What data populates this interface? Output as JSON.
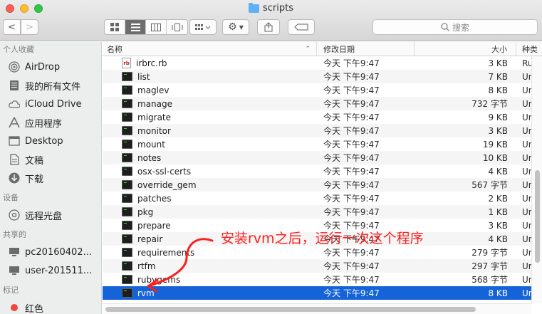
{
  "window": {
    "title": "scripts"
  },
  "toolbar": {
    "back_label": "<",
    "forward_label": ">",
    "search_placeholder": "搜索"
  },
  "sidebar": {
    "sections": [
      {
        "title": "个人收藏",
        "items": [
          {
            "label": "AirDrop",
            "icon": "airdrop-icon"
          },
          {
            "label": "我的所有文件",
            "icon": "all-files-icon"
          },
          {
            "label": "iCloud Drive",
            "icon": "cloud-icon"
          },
          {
            "label": "应用程序",
            "icon": "applications-icon"
          },
          {
            "label": "Desktop",
            "icon": "desktop-icon"
          },
          {
            "label": "文稿",
            "icon": "documents-icon"
          },
          {
            "label": "下载",
            "icon": "downloads-icon"
          }
        ]
      },
      {
        "title": "设备",
        "items": [
          {
            "label": "远程光盘",
            "icon": "disc-icon"
          }
        ]
      },
      {
        "title": "共享的",
        "items": [
          {
            "label": "pc20160402...",
            "icon": "computer-icon"
          },
          {
            "label": "user-201511...",
            "icon": "computer-icon"
          }
        ]
      },
      {
        "title": "标记",
        "items": [
          {
            "label": "红色",
            "icon": "red-tag-icon"
          }
        ]
      }
    ]
  },
  "columns": {
    "name": "名称",
    "date": "修改日期",
    "size": "大小",
    "kind": "种类"
  },
  "files": [
    {
      "name": "irbrc.rb",
      "date": "今天 下午9:47",
      "size": "3 KB",
      "kind": "Ruby",
      "icon": "ruby-file-icon"
    },
    {
      "name": "list",
      "date": "今天 下午9:47",
      "size": "7 KB",
      "kind": "Unix",
      "icon": "terminal-icon"
    },
    {
      "name": "maglev",
      "date": "今天 下午9:47",
      "size": "8 KB",
      "kind": "Unix",
      "icon": "terminal-icon"
    },
    {
      "name": "manage",
      "date": "今天 下午9:47",
      "size": "732 字节",
      "kind": "Unix",
      "icon": "terminal-icon"
    },
    {
      "name": "migrate",
      "date": "今天 下午9:47",
      "size": "9 KB",
      "kind": "Unix",
      "icon": "terminal-icon"
    },
    {
      "name": "monitor",
      "date": "今天 下午9:47",
      "size": "3 KB",
      "kind": "Unix",
      "icon": "terminal-icon"
    },
    {
      "name": "mount",
      "date": "今天 下午9:47",
      "size": "19 KB",
      "kind": "Unix",
      "icon": "terminal-icon"
    },
    {
      "name": "notes",
      "date": "今天 下午9:47",
      "size": "10 KB",
      "kind": "Unix",
      "icon": "terminal-icon"
    },
    {
      "name": "osx-ssl-certs",
      "date": "今天 下午9:47",
      "size": "4 KB",
      "kind": "Unix",
      "icon": "terminal-icon"
    },
    {
      "name": "override_gem",
      "date": "今天 下午9:47",
      "size": "567 字节",
      "kind": "Unix",
      "icon": "terminal-icon"
    },
    {
      "name": "patches",
      "date": "今天 下午9:47",
      "size": "2 KB",
      "kind": "Unix",
      "icon": "terminal-icon"
    },
    {
      "name": "pkg",
      "date": "今天 下午9:47",
      "size": "1 KB",
      "kind": "Unix",
      "icon": "terminal-icon"
    },
    {
      "name": "prepare",
      "date": "今天 下午9:47",
      "size": "3 KB",
      "kind": "Unix",
      "icon": "terminal-icon"
    },
    {
      "name": "repair",
      "date": "今天 下午9:47",
      "size": "4 KB",
      "kind": "Unix",
      "icon": "terminal-icon"
    },
    {
      "name": "requirements",
      "date": "今天 下午9:47",
      "size": "279 字节",
      "kind": "Unix",
      "icon": "terminal-icon"
    },
    {
      "name": "rtfm",
      "date": "今天 下午9:47",
      "size": "297 字节",
      "kind": "Unix",
      "icon": "terminal-icon"
    },
    {
      "name": "rubygems",
      "date": "今天 下午9:47",
      "size": "568 字节",
      "kind": "Unix",
      "icon": "terminal-icon"
    },
    {
      "name": "rvm",
      "date": "今天 下午9:47",
      "size": "8 KB",
      "kind": "Unix",
      "icon": "terminal-icon",
      "selected": true
    }
  ],
  "annotation": {
    "text": "安装rvm之后，运行一次这个程序",
    "color": "#ff1d1d"
  },
  "colors": {
    "selection": "#1563d8",
    "accent_folder": "#5fb1f3"
  }
}
